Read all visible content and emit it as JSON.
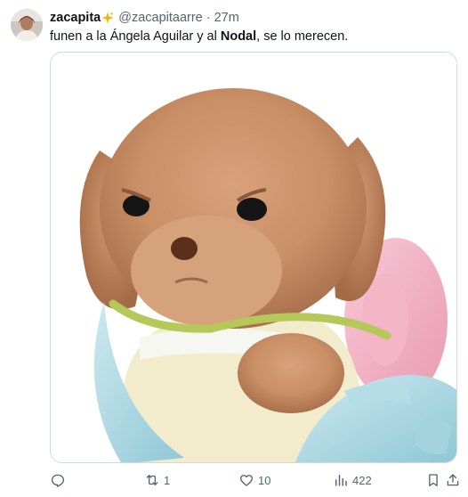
{
  "tweet": {
    "display_name": "zacapita",
    "handle": "@zacapitaarre",
    "separator": "·",
    "time": "27m",
    "text_before": "funen a la Ángela Aguilar y al ",
    "text_bold": "Nodal",
    "text_after": ", se lo merecen.",
    "media": {
      "description_icon": "plush-puppy-image"
    }
  },
  "actions": {
    "reply_count": "",
    "retweet_count": "1",
    "like_count": "10",
    "views_count": "422"
  },
  "colors": {
    "text": "#0f1419",
    "secondary": "#536471",
    "border": "#cfd9de"
  }
}
